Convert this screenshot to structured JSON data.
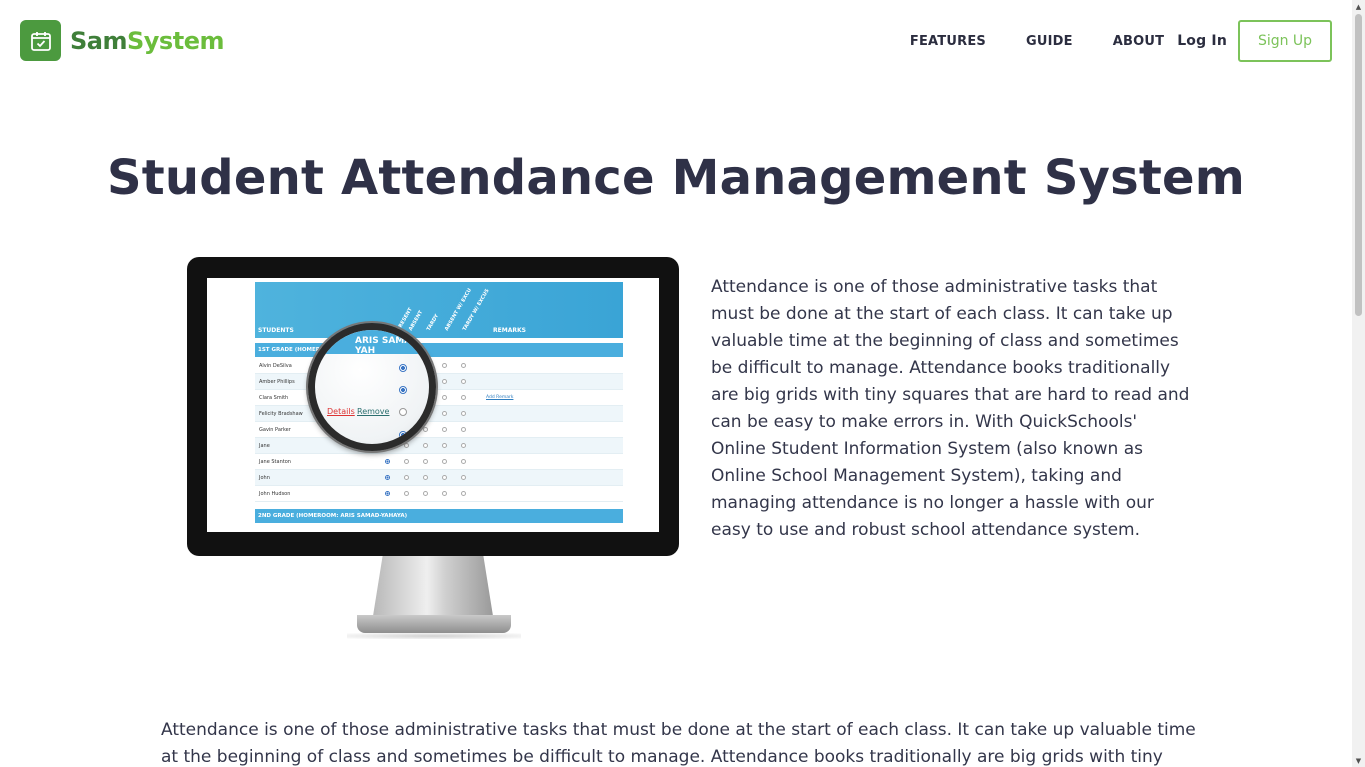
{
  "header": {
    "logo_part1": "Sam",
    "logo_part2": "System",
    "logo_icon": "calendar-check-icon",
    "nav": {
      "features": "FEATURES",
      "guide": "GUIDE",
      "about": "ABOUT",
      "login": "Log In",
      "signup": "Sign Up"
    }
  },
  "main": {
    "title": "Student Attendance Management System",
    "intro": "Attendance is one of those administrative tasks that must be done at the start of each class. It can take up valuable time at the beginning of class and sometimes be difficult to manage. Attendance books traditionally are big grids with tiny squares that are hard to read and can be easy to make errors in. With QuickSchools' Online Student Information System (also known as Online School Management System), taking and managing attendance is no longer a hassle with our easy to use and robust school attendance system.",
    "body": "Attendance is one of those administrative tasks that must be done at the start of each class. It can take up valuable time at the beginning of class and sometimes be difficult to manage. Attendance books traditionally are big grids with tiny squares"
  },
  "screenshot": {
    "students_header": "STUDENTS",
    "remarks_header": "REMARKS",
    "columns": [
      "PRESENT",
      "ABSENT",
      "TARDY",
      "ABSENT W/ EXCU",
      "TARDY W/ EXCUS"
    ],
    "grade1": "1ST GRADE (HOMEROOM: ARIS SAMAD-YAHAYA)",
    "grade2": "2ND GRADE (HOMEROOM: ARIS SAMAD-YAHAYA)",
    "students": [
      "Alvin DeSilva",
      "Amber Phillips",
      "Clara Smith",
      "Felicity Bradshaw",
      "Gavin Parker",
      "Jane",
      "Jane Stanton",
      "John",
      "John Hudson"
    ],
    "add_remark": "Add Remark",
    "mag_heading": "ARIS SAMAD-YAH",
    "mag_details": "Details",
    "mag_remove": "Remove"
  },
  "colors": {
    "brand_dark": "#3f7f39",
    "brand_light": "#6bbd3c",
    "signup_border": "#7cc35a",
    "title_text": "#2f3147",
    "table_blue": "#4aaede"
  }
}
